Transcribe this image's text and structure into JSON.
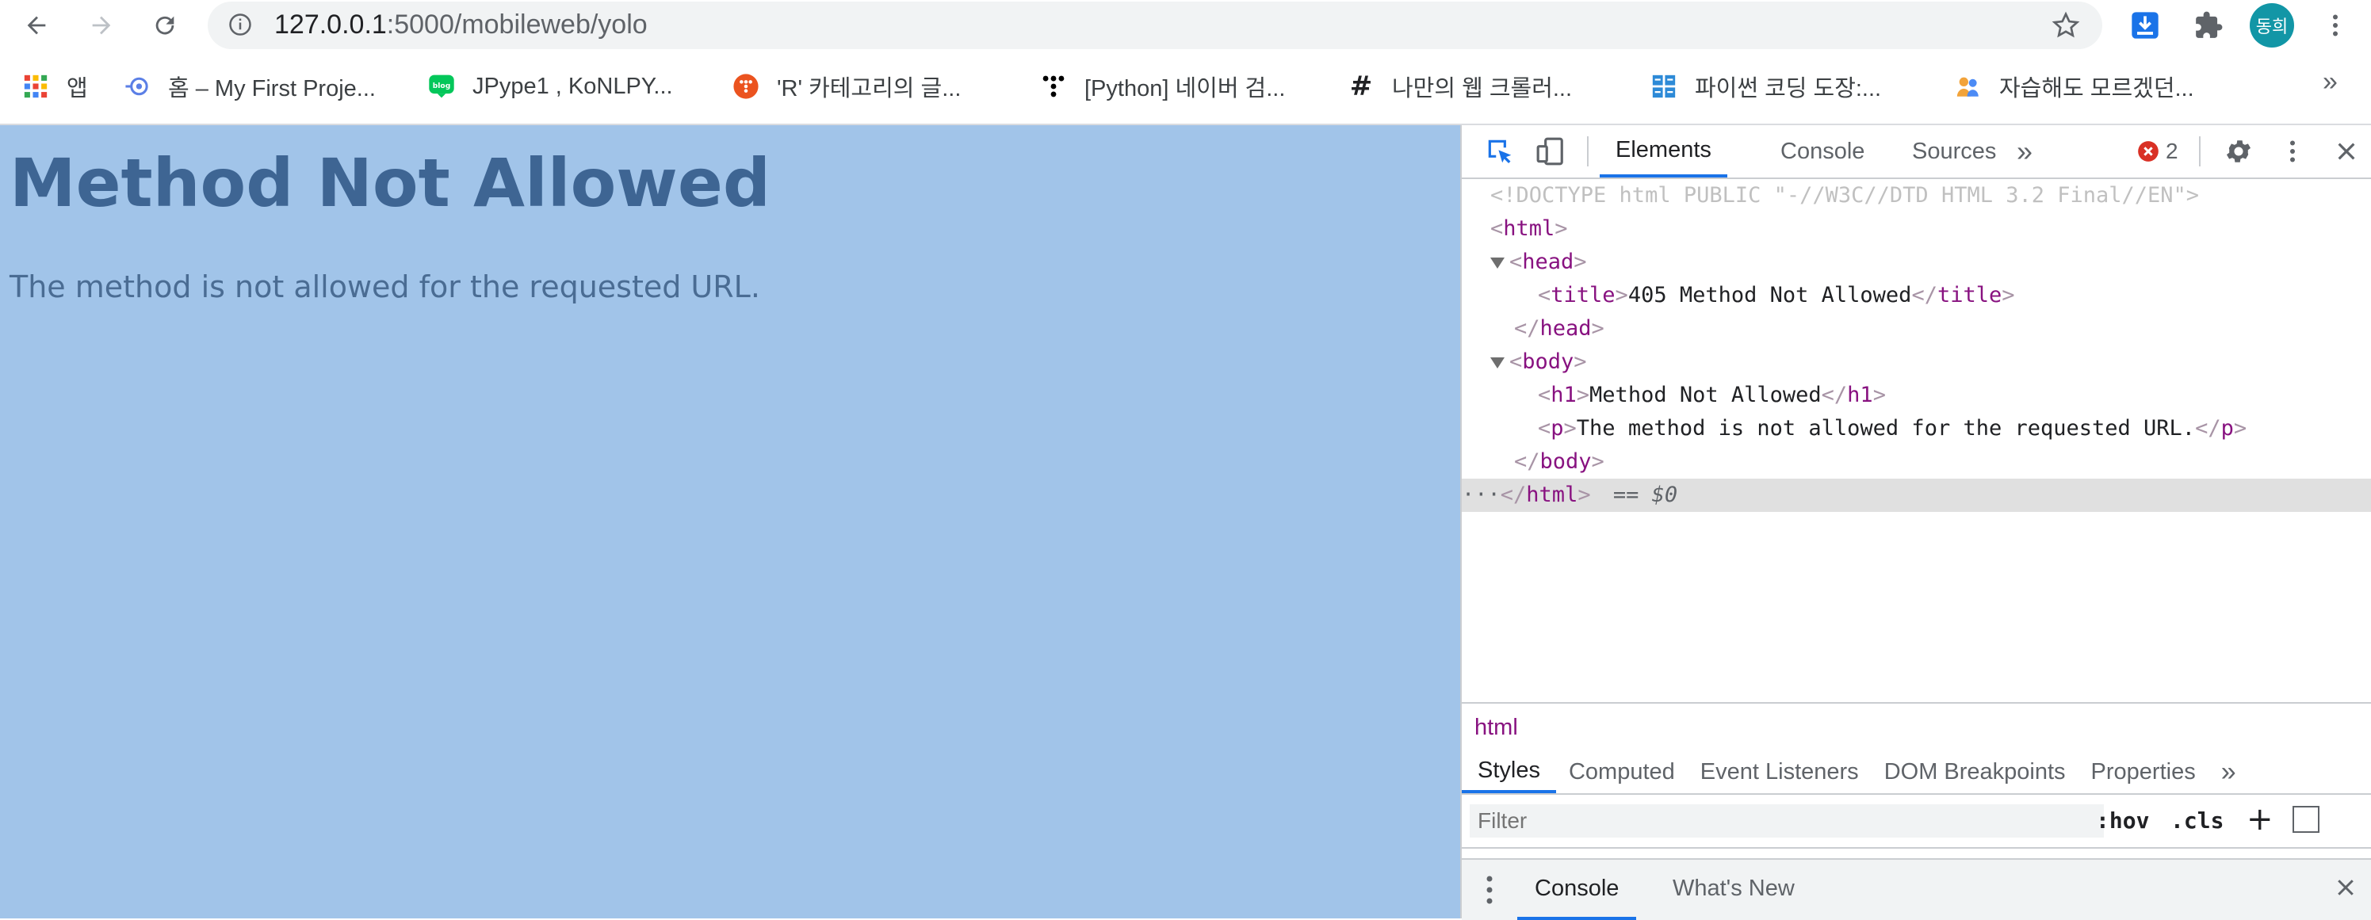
{
  "browser": {
    "url_host": "127.0.0.1",
    "url_path": ":5000/mobileweb/yolo",
    "profile_initials": "동희"
  },
  "bookmarks": [
    {
      "label": "앱",
      "icon": "apps-grid-icon"
    },
    {
      "label": "홈 – My First Proje...",
      "icon": "site-icon"
    },
    {
      "label": "JPype1 , KoNLPY...",
      "icon": "blog-icon"
    },
    {
      "label": "'R' 카테고리의 글...",
      "icon": "tistory-icon"
    },
    {
      "label": "[Python] 네이버 검...",
      "icon": "dots-icon"
    },
    {
      "label": "나만의 웹 크롤러...",
      "icon": "hash-icon"
    },
    {
      "label": "파이썬 코딩 도장:...",
      "icon": "dojang-icon"
    },
    {
      "label": "자습해도 모르겠던...",
      "icon": "people-icon"
    }
  ],
  "page": {
    "heading": "Method Not Allowed",
    "message": "The method is not allowed for the requested URL."
  },
  "devtools": {
    "tabs": [
      "Elements",
      "Console",
      "Sources"
    ],
    "error_count": "2",
    "dom": {
      "doctype": "<!DOCTYPE html PUBLIC \"-//W3C//DTD HTML 3.2 Final//EN\">",
      "title_text": "405 Method Not Allowed",
      "h1_text": "Method Not Allowed",
      "p_text": "The method is not allowed for the requested URL.",
      "selected_marker": "== $0"
    },
    "breadcrumb": "html",
    "style_tabs": [
      "Styles",
      "Computed",
      "Event Listeners",
      "DOM Breakpoints",
      "Properties"
    ],
    "filter_placeholder": "Filter",
    "hov_label": ":hov",
    "cls_label": ".cls",
    "drawer_tabs": [
      "Console",
      "What's New"
    ]
  },
  "colors": {
    "page_bg": "#a1c4e9",
    "heading": "#3e6593",
    "accent": "#1a73e8"
  }
}
